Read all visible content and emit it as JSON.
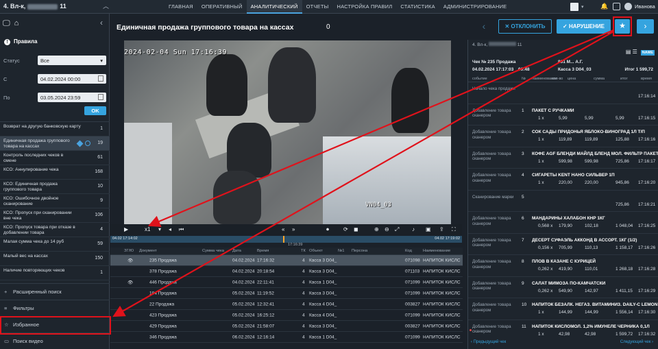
{
  "header": {
    "store_prefix": "4. Вл-к,",
    "store_suffix": "11",
    "chevron": "︿",
    "nav": [
      "ГЛАВНАЯ",
      "ОПЕРАТИВНЫЙ",
      "АНАЛИТИЧЕСКИЙ",
      "ОТЧЕТЫ",
      "НАСТРОЙКА ПРАВИЛ",
      "СТАТИСТИКА",
      "АДМИНИСТРИРОВАНИЕ"
    ],
    "user": "Иванова"
  },
  "left": {
    "rules_title": "Правила",
    "status_label": "Статус",
    "status_value": "Все",
    "from_label": "С",
    "from_value": "04.02.2024 00:00",
    "to_label": "По",
    "to_value": "03.05.2024 23:59",
    "ok_label": "OK",
    "rules": [
      {
        "name": "Возврат на другую банковскую карту",
        "count": "1"
      },
      {
        "name": "Единичная продажа группового товара на кассах",
        "count": "19"
      },
      {
        "name": "Контроль последних чеков в смене",
        "count": "61"
      },
      {
        "name": "КСО: Аннулирование чека",
        "count": "168"
      },
      {
        "name": "КСО: Единичная продажа группового товара",
        "count": "10"
      },
      {
        "name": "КСО: Ошибочное двойное сканирование",
        "count": "9"
      },
      {
        "name": "КСО: Пропуск при сканировании вне чека",
        "count": "106"
      },
      {
        "name": "КСО: Пропуск товара при отказе в добавлении товара",
        "count": "4"
      },
      {
        "name": "Малая сумма чека до 14 руб",
        "count": "59"
      },
      {
        "name": "Малый вес на кассах",
        "count": "150"
      },
      {
        "name": "Наличие повторяющих чеков",
        "count": "1"
      }
    ],
    "bottom": [
      {
        "icon": "+",
        "label": "Расширенный поиск"
      },
      {
        "icon": "≡",
        "label": "Фильтры"
      },
      {
        "icon": "☆",
        "label": "Избранное"
      },
      {
        "icon": "▭",
        "label": "Поиск видео"
      }
    ]
  },
  "center": {
    "title": "Единичная продажа группового товара на кассах",
    "count": "0",
    "video_timestamp": "2024-02-04 Sun 17:16:39",
    "camera": "VN04_03",
    "speed": "x1",
    "timeline_start": "04.02 17:14:02",
    "timeline_end": "04.02 17:19:02",
    "timeline_center": "17:16:39",
    "table": {
      "headers": [
        "ЗГ/Ю",
        "Документ",
        "Сумма чека",
        "Дата",
        "Время",
        "ТК",
        "Объект",
        "№1",
        "Персона",
        "Код",
        "Наименование"
      ],
      "rows": [
        [
          "235 Продажа",
          "04.02.2024",
          "17:16:32",
          "4",
          "Касса 3 D04_",
          "",
          "071098",
          "НАПИТОК КИСЛС"
        ],
        [
          "378 Продажа",
          "04.02.2024",
          "20:18:54",
          "4",
          "Касса 3 D04_",
          "",
          "071103",
          "НАПИТОК КИСЛС"
        ],
        [
          "446 Продажа",
          "04.02.2024",
          "22:11:41",
          "4",
          "Касса 1 D04_",
          "",
          "071099",
          "НАПИТОК КИСЛС"
        ],
        [
          "184 Продажа",
          "05.02.2024",
          "11:19:52",
          "4",
          "Касса 3 D04_",
          "",
          "071099",
          "НАПИТОК КИСЛС"
        ],
        [
          "22 Продажа",
          "05.02.2024",
          "12:32:41",
          "4",
          "Касса 4 D04_",
          "",
          "003827",
          "НАПИТОК КИСЛС"
        ],
        [
          "423 Продажа",
          "05.02.2024",
          "16:25:12",
          "4",
          "Касса 4 D04_",
          "",
          "071099",
          "НАПИТОК КИСЛС"
        ],
        [
          "429 Продажа",
          "05.02.2024",
          "21:58:07",
          "4",
          "Касса 3 D04_",
          "",
          "003827",
          "НАПИТОК КИСЛС"
        ],
        [
          "346 Продажа",
          "06.02.2024",
          "12:16:14",
          "4",
          "Касса 1 D04_",
          "",
          "071099",
          "НАПИТОК КИСЛС"
        ]
      ]
    }
  },
  "actions": {
    "reject": "ОТКЛОНИТЬ",
    "violation": "НАРУШЕНИЕ"
  },
  "receipt": {
    "store": "4. Вл-к,",
    "store_suffix": "11",
    "name_badge": "NAME",
    "check": "Чек № 235 Продажа",
    "cashier": "801 М... А.Г.",
    "date": "04.02.2024 17:17:03",
    "dur": "00:48",
    "kassa": "Касса 3 D04_03",
    "total": "Итог 1 599,72",
    "cols": [
      "событие",
      "№",
      "наименование",
      "кол-во",
      "цена",
      "сумма",
      "итог",
      "время"
    ],
    "items": [
      {
        "ev": "Начало чека продажи",
        "num": "",
        "name": "",
        "q": "",
        "p": "",
        "s": "",
        "t": "",
        "time": "17:16:14"
      },
      {
        "ev": "Добавление товара сканером",
        "num": "1",
        "name": "ПАКЕТ С РУЧКАМИ",
        "q": "1 х",
        "p": "5,99",
        "s": "5,99",
        "t": "5,99",
        "time": "17:16:15"
      },
      {
        "ev": "Добавление товара сканером",
        "num": "2",
        "name": "СОК САДЫ ПРИДОНЬЯ ЯБЛОКО-ВИНОГРАД 1Л Т/П",
        "q": "1 х",
        "p": "119,89",
        "s": "119,89",
        "t": "125,88",
        "time": "17:16:16"
      },
      {
        "ev": "Добавление товара сканером",
        "num": "3",
        "name": "КОФЕ AGF БЛЕНДИ МАЙЛД БЛЕНД МОЛ. ФИЛЬТР ПАКЕТ",
        "q": "1 х",
        "p": "599,98",
        "s": "599,98",
        "t": "725,86",
        "time": "17:16:17"
      },
      {
        "ev": "Добавление товара сканером",
        "num": "4",
        "name": "СИГАРЕТЫ KENT НАНО СИЛЬВЕР 1П",
        "q": "1 х",
        "p": "220,00",
        "s": "220,00",
        "t": "945,86",
        "time": "17:16:20"
      },
      {
        "ev": "Сканирование марки",
        "num": "5",
        "name": "",
        "q": "",
        "p": "",
        "s": "",
        "t": "725,86",
        "time": "17:16:21"
      },
      {
        "ev": "Добавление товара сканером",
        "num": "6",
        "name": "МАНДАРИНЫ ХАЛАБОН КНР 1КГ",
        "q": "0,568 х",
        "p": "179,90",
        "s": "102,18",
        "t": "1 048,04",
        "time": "17:16:25"
      },
      {
        "ev": "Добавление товара сканером",
        "num": "7",
        "name": "ДЕСЕРТ СУФАЭЛЬ АККОНД В АССОРТ. 1КГ (1/2)",
        "q": "0,156 х",
        "p": "705,99",
        "s": "110,13",
        "t": "1 158,17",
        "time": "17:16:26"
      },
      {
        "ev": "Добавление товара сканером",
        "num": "8",
        "name": "ПЛОВ В КАЗАНЕ С КУРИЦЕЙ",
        "q": "0,262 х",
        "p": "419,90",
        "s": "110,01",
        "t": "1 268,18",
        "time": "17:16:28"
      },
      {
        "ev": "Добавление товара сканером",
        "num": "9",
        "name": "САЛАТ МИМОЗА ПО-КАМЧАТСКИ",
        "q": "0,262 х",
        "p": "549,90",
        "s": "142,97",
        "t": "1 411,15",
        "time": "17:16:29"
      },
      {
        "ev": "Добавление товара сканером",
        "num": "10",
        "name": "НАПИТОК БЕЗАЛК. НЕГАЗ. ВИТАМИНИЗ. DAILY-C LEMON",
        "q": "1 х",
        "p": "144,99",
        "s": "144,99",
        "t": "1 556,14",
        "time": "17:16:30"
      },
      {
        "ev": "Добавление товара сканером",
        "num": "11",
        "name": "НАПИТОК КИСЛОМОЛ. 1,2% ИМУНЕЛЕ ЧЕРНИКА 0,1Л",
        "q": "1 х",
        "p": "42,98",
        "s": "42,98",
        "t": "1 599,72",
        "time": "17:16:32"
      }
    ],
    "prev": "‹ Предыдущий чек",
    "next": "Следующий чек ›"
  }
}
